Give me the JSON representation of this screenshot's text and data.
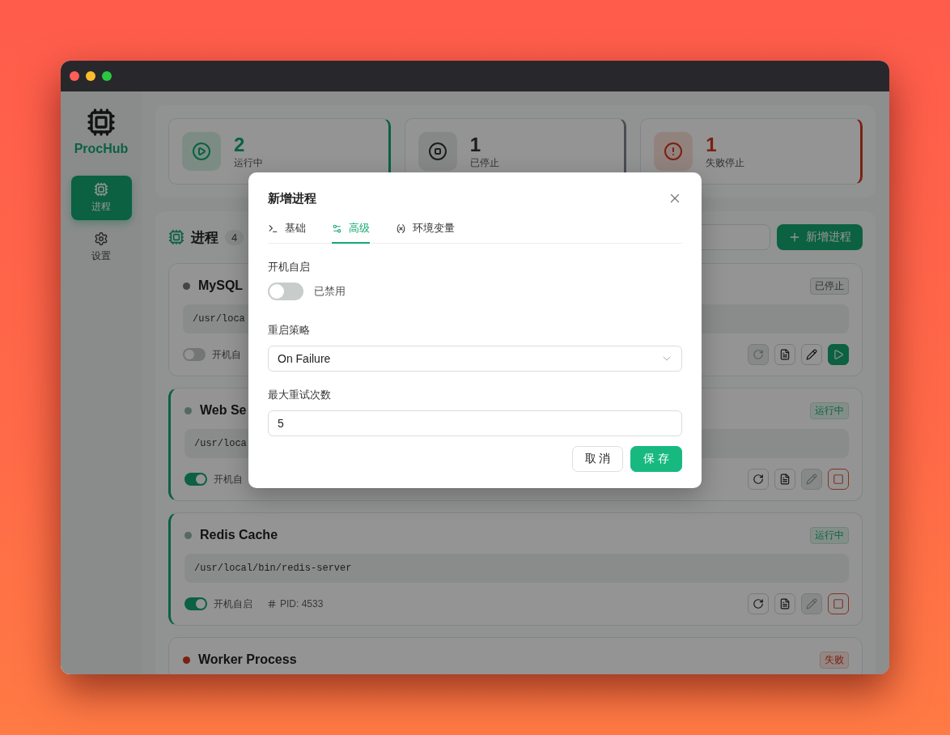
{
  "sidebar": {
    "logo": "ProcHub",
    "items": [
      {
        "label": "进程",
        "selected": true
      },
      {
        "label": "设置",
        "selected": false
      }
    ]
  },
  "stats": [
    {
      "kind": "running",
      "value": "2",
      "label": "运行中"
    },
    {
      "kind": "stopped",
      "value": "1",
      "label": "已停止"
    },
    {
      "kind": "failed",
      "value": "1",
      "label": "失败停止"
    }
  ],
  "processes": {
    "title": "进程",
    "count": "4",
    "add_button": "新增进程",
    "items": [
      {
        "name": "MySQL",
        "kind": "stopped",
        "badge": "已停止",
        "command": "/usr/loca",
        "autostart": false,
        "autostart_label": "开机自",
        "actions": [
          {
            "kind": "restart",
            "disabled": true
          },
          {
            "kind": "logs",
            "disabled": false
          },
          {
            "kind": "edit",
            "disabled": false
          },
          {
            "kind": "start",
            "disabled": false
          }
        ]
      },
      {
        "name": "Web Se",
        "kind": "running",
        "badge": "运行中",
        "command": "/usr/loca",
        "autostart": true,
        "autostart_label": "开机自",
        "actions": [
          {
            "kind": "restart",
            "disabled": false
          },
          {
            "kind": "logs",
            "disabled": false
          },
          {
            "kind": "edit",
            "disabled": true
          },
          {
            "kind": "stop",
            "disabled": false
          }
        ]
      },
      {
        "name": "Redis Cache",
        "kind": "running",
        "badge": "运行中",
        "command": "/usr/local/bin/redis-server",
        "autostart": true,
        "autostart_label": "开机自启",
        "pid": "PID: 4533",
        "actions": [
          {
            "kind": "restart",
            "disabled": false
          },
          {
            "kind": "logs",
            "disabled": false
          },
          {
            "kind": "edit",
            "disabled": true
          },
          {
            "kind": "stop",
            "disabled": false
          }
        ]
      },
      {
        "name": "Worker Process",
        "kind": "failed",
        "badge": "失败"
      }
    ]
  },
  "dialog": {
    "title": "新增进程",
    "tabs": [
      {
        "label": "基础",
        "selected": false
      },
      {
        "label": "高级",
        "selected": true
      },
      {
        "label": "环境变量",
        "selected": false
      }
    ],
    "fields": [
      {
        "kind": "toggle",
        "label": "开机自启",
        "on": false,
        "state_label": "已禁用"
      },
      {
        "kind": "select",
        "label": "重启策略",
        "value": "On Failure"
      },
      {
        "kind": "input",
        "label": "最大重试次数",
        "value": "5"
      }
    ],
    "buttons": [
      {
        "kind": "secondary",
        "label": "取 消"
      },
      {
        "kind": "primary",
        "label": "保 存"
      }
    ]
  }
}
